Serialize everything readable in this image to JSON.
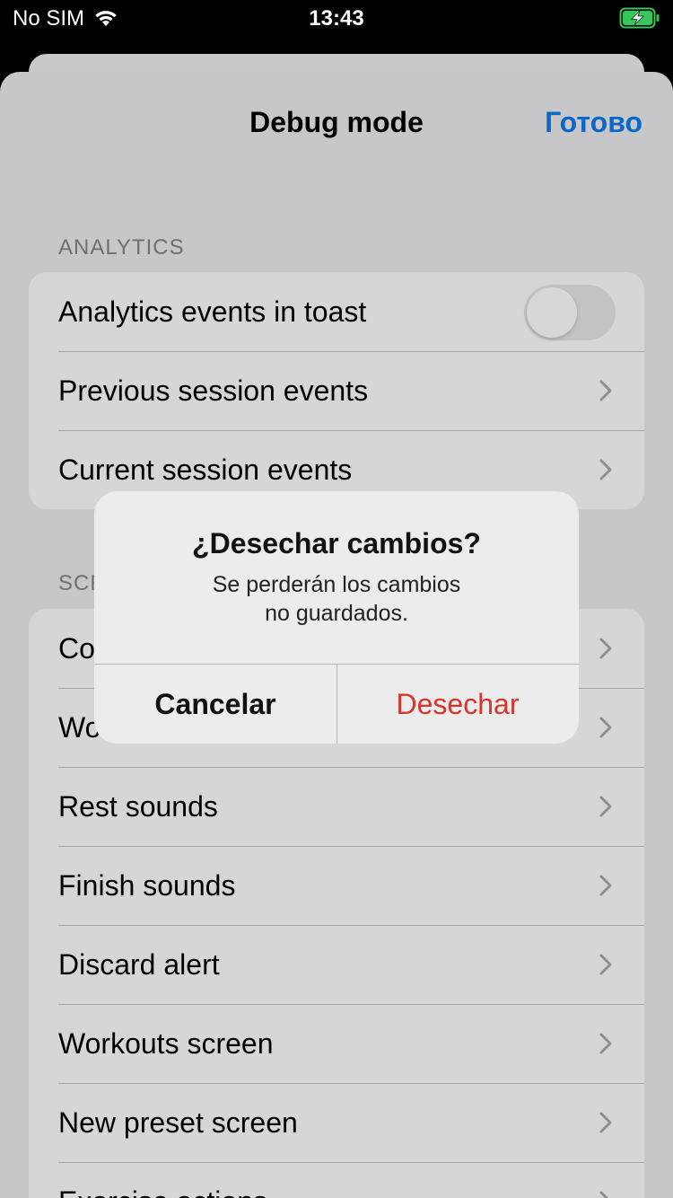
{
  "status_bar": {
    "carrier": "No SIM",
    "time": "13:43"
  },
  "nav": {
    "title": "Debug mode",
    "done_label": "Готово"
  },
  "sections": {
    "analytics": {
      "header": "ANALYTICS",
      "toggle_on": false,
      "items": [
        "Analytics events in toast",
        "Previous session events",
        "Current session events"
      ]
    },
    "screens": {
      "header_visible": "SCR",
      "items": [
        "Co",
        "Wo",
        "Rest sounds",
        "Finish sounds",
        "Discard alert",
        "Workouts screen",
        "New preset screen",
        "Exercise actions"
      ]
    }
  },
  "alert": {
    "title": "¿Desechar cambios?",
    "message_line1": "Se perderán los cambios",
    "message_line2": "no guardados.",
    "cancel_label": "Cancelar",
    "discard_label": "Desechar"
  },
  "colors": {
    "accent": "#0a68c8",
    "destructive": "#d6342c",
    "battery": "#34c759"
  }
}
